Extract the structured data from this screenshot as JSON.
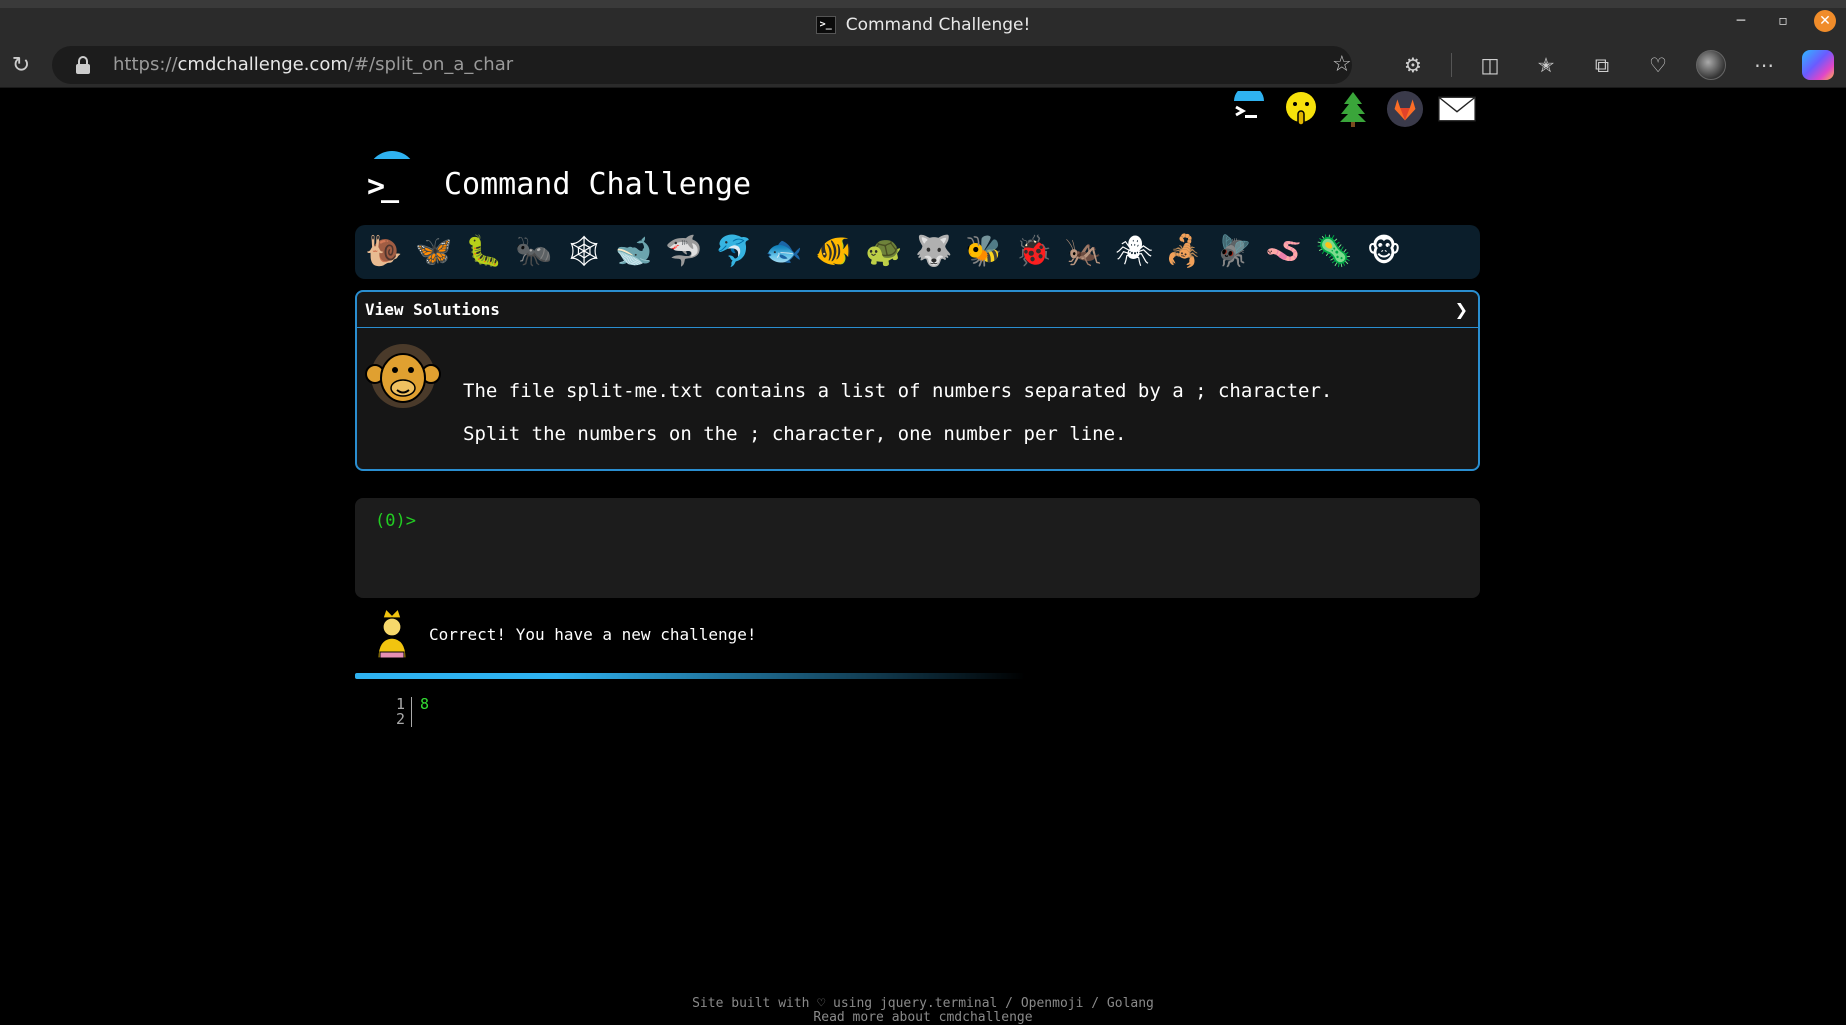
{
  "browser": {
    "window_title": "Command Challenge!",
    "url_prefix": "https://",
    "url_host": "cmdchallenge.com",
    "url_path": "/#/split_on_a_char",
    "icons": [
      "reload-icon",
      "lock-icon",
      "star-icon",
      "extensions-icon",
      "split-screen-icon",
      "favorites-icon",
      "collections-icon",
      "browser-essentials-icon",
      "profile-avatar",
      "copilot-icon",
      "more-icon"
    ]
  },
  "site": {
    "title": "Command Challenge",
    "header_icons": [
      "terminal-logo-icon",
      "shushing-face-icon",
      "evergreen-tree-icon",
      "gitlab-icon",
      "envelope-icon"
    ]
  },
  "challenge_icons": [
    "snail",
    "butterfly",
    "caterpillar",
    "ant",
    "spider-web",
    "whale",
    "shark",
    "dolphin",
    "fish",
    "tropical-fish",
    "turtle",
    "wolf",
    "bee",
    "ladybug",
    "cricket",
    "spider",
    "scorpion",
    "fly",
    "worm",
    "microbe",
    "monkey"
  ],
  "solutions": {
    "label": "View Solutions",
    "chevron": "❯",
    "description_line1": "The file split-me.txt contains a list of numbers separated by a ; character.",
    "description_line2": "Split the numbers on the ; character, one number per line."
  },
  "terminal": {
    "prompt": "(0)>"
  },
  "result": {
    "message": "Correct! You have a new challenge!",
    "progress": 0.35
  },
  "output": {
    "lines": [
      {
        "num": "1",
        "text": "8"
      },
      {
        "num": "2",
        "text": ""
      }
    ]
  },
  "footer": {
    "line1": "Site built with ♡ using jquery.terminal / Openmoji / Golang",
    "line2": "Read more about cmdchallenge"
  },
  "colors": {
    "accent": "#2fb2f0",
    "prompt_green": "#22cc22",
    "panel_border": "#2a8ed0",
    "strip_bg": "#0b1e2b"
  }
}
